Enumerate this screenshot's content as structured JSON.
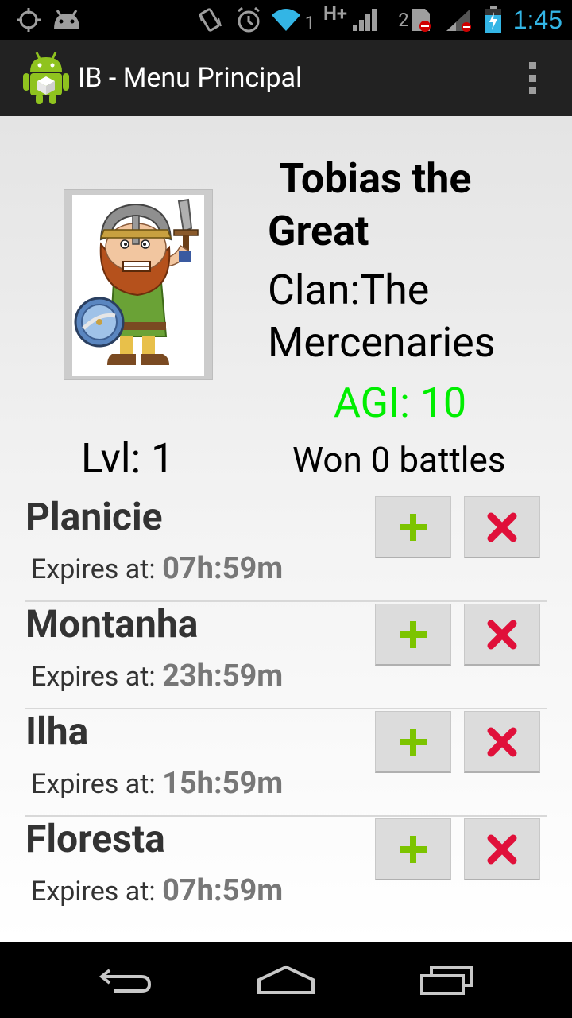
{
  "status_bar": {
    "time": "1:45",
    "signal_network": "H+",
    "wifi_sub": "1",
    "sim_slot": "2",
    "accent_color": "#33b5e5"
  },
  "action_bar": {
    "title": "IB - Menu Principal",
    "icon": "android-app-icon"
  },
  "hero": {
    "name_line1": "Tobias the",
    "name_line2": "Great",
    "clan_line1": "Clan:The",
    "clan_line2": "Mercenaries",
    "agi": "AGI: 10",
    "level": "Lvl: 1",
    "won": "Won 0 battles",
    "agi_color": "#00ee00"
  },
  "items": [
    {
      "name": "Planicie",
      "expires_label": "Expires at: ",
      "expires_time": "07h:59m"
    },
    {
      "name": "Montanha",
      "expires_label": "Expires at: ",
      "expires_time": "23h:59m"
    },
    {
      "name": "Ilha",
      "expires_label": "Expires at: ",
      "expires_time": "15h:59m"
    },
    {
      "name": "Floresta",
      "expires_label": "Expires at: ",
      "expires_time": "07h:59m"
    }
  ],
  "item_buttons": {
    "add_icon": "plus-icon",
    "remove_icon": "close-x-icon",
    "add_color": "#7cc400",
    "remove_color": "#e0103a"
  },
  "nav_bar": {
    "back_icon": "back-icon",
    "home_icon": "home-icon",
    "recents_icon": "recents-icon"
  }
}
